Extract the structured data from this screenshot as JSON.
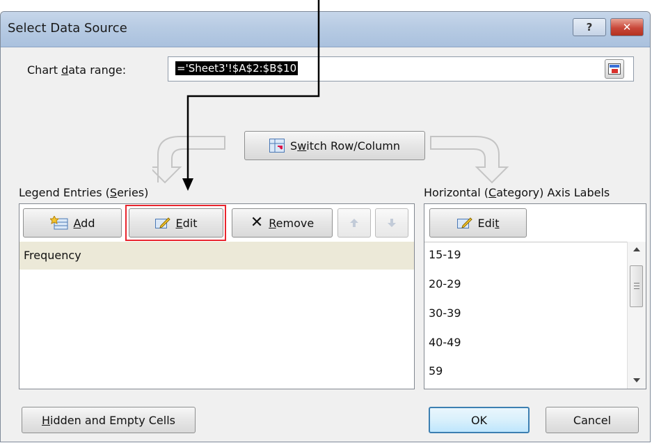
{
  "dialog": {
    "title": "Select Data Source",
    "help_label": "?",
    "close_label": "✕"
  },
  "chart_range": {
    "label_pre": "Chart ",
    "label_u": "d",
    "label_post": "ata range:",
    "value": "='Sheet3'!$A$2:$B$10"
  },
  "switch": {
    "pre": "S",
    "u": "w",
    "post": "itch Row/Column"
  },
  "legend": {
    "heading_pre": "Legend Entries (",
    "heading_u": "S",
    "heading_post": "eries)",
    "add_u": "A",
    "add_post": "dd",
    "edit_u": "E",
    "edit_post": "dit",
    "remove_u": "R",
    "remove_post": "emove",
    "items": [
      "Frequency"
    ]
  },
  "axis": {
    "heading_pre": "Horizontal (",
    "heading_u": "C",
    "heading_post": "ategory) Axis Labels",
    "edit_pre": "Edi",
    "edit_u": "t",
    "items": [
      "15-19",
      "20-29",
      "30-39",
      "40-49",
      "59"
    ]
  },
  "footer": {
    "hidden_u": "H",
    "hidden_post": "idden and Empty Cells",
    "ok": "OK",
    "cancel": "Cancel"
  },
  "colors": {
    "highlight_box": "#e8252e",
    "selected_row": "#ece9d8",
    "arrow": "#000000"
  }
}
